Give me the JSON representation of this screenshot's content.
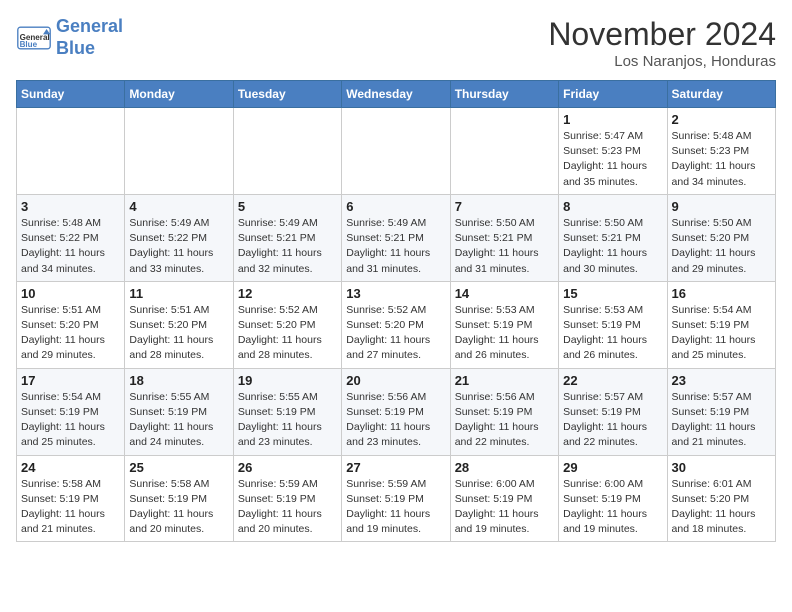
{
  "header": {
    "logo_line1": "General",
    "logo_line2": "Blue",
    "month_year": "November 2024",
    "location": "Los Naranjos, Honduras"
  },
  "days_of_week": [
    "Sunday",
    "Monday",
    "Tuesday",
    "Wednesday",
    "Thursday",
    "Friday",
    "Saturday"
  ],
  "weeks": [
    [
      {
        "day": "",
        "info": ""
      },
      {
        "day": "",
        "info": ""
      },
      {
        "day": "",
        "info": ""
      },
      {
        "day": "",
        "info": ""
      },
      {
        "day": "",
        "info": ""
      },
      {
        "day": "1",
        "info": "Sunrise: 5:47 AM\nSunset: 5:23 PM\nDaylight: 11 hours\nand 35 minutes."
      },
      {
        "day": "2",
        "info": "Sunrise: 5:48 AM\nSunset: 5:23 PM\nDaylight: 11 hours\nand 34 minutes."
      }
    ],
    [
      {
        "day": "3",
        "info": "Sunrise: 5:48 AM\nSunset: 5:22 PM\nDaylight: 11 hours\nand 34 minutes."
      },
      {
        "day": "4",
        "info": "Sunrise: 5:49 AM\nSunset: 5:22 PM\nDaylight: 11 hours\nand 33 minutes."
      },
      {
        "day": "5",
        "info": "Sunrise: 5:49 AM\nSunset: 5:21 PM\nDaylight: 11 hours\nand 32 minutes."
      },
      {
        "day": "6",
        "info": "Sunrise: 5:49 AM\nSunset: 5:21 PM\nDaylight: 11 hours\nand 31 minutes."
      },
      {
        "day": "7",
        "info": "Sunrise: 5:50 AM\nSunset: 5:21 PM\nDaylight: 11 hours\nand 31 minutes."
      },
      {
        "day": "8",
        "info": "Sunrise: 5:50 AM\nSunset: 5:21 PM\nDaylight: 11 hours\nand 30 minutes."
      },
      {
        "day": "9",
        "info": "Sunrise: 5:50 AM\nSunset: 5:20 PM\nDaylight: 11 hours\nand 29 minutes."
      }
    ],
    [
      {
        "day": "10",
        "info": "Sunrise: 5:51 AM\nSunset: 5:20 PM\nDaylight: 11 hours\nand 29 minutes."
      },
      {
        "day": "11",
        "info": "Sunrise: 5:51 AM\nSunset: 5:20 PM\nDaylight: 11 hours\nand 28 minutes."
      },
      {
        "day": "12",
        "info": "Sunrise: 5:52 AM\nSunset: 5:20 PM\nDaylight: 11 hours\nand 28 minutes."
      },
      {
        "day": "13",
        "info": "Sunrise: 5:52 AM\nSunset: 5:20 PM\nDaylight: 11 hours\nand 27 minutes."
      },
      {
        "day": "14",
        "info": "Sunrise: 5:53 AM\nSunset: 5:19 PM\nDaylight: 11 hours\nand 26 minutes."
      },
      {
        "day": "15",
        "info": "Sunrise: 5:53 AM\nSunset: 5:19 PM\nDaylight: 11 hours\nand 26 minutes."
      },
      {
        "day": "16",
        "info": "Sunrise: 5:54 AM\nSunset: 5:19 PM\nDaylight: 11 hours\nand 25 minutes."
      }
    ],
    [
      {
        "day": "17",
        "info": "Sunrise: 5:54 AM\nSunset: 5:19 PM\nDaylight: 11 hours\nand 25 minutes."
      },
      {
        "day": "18",
        "info": "Sunrise: 5:55 AM\nSunset: 5:19 PM\nDaylight: 11 hours\nand 24 minutes."
      },
      {
        "day": "19",
        "info": "Sunrise: 5:55 AM\nSunset: 5:19 PM\nDaylight: 11 hours\nand 23 minutes."
      },
      {
        "day": "20",
        "info": "Sunrise: 5:56 AM\nSunset: 5:19 PM\nDaylight: 11 hours\nand 23 minutes."
      },
      {
        "day": "21",
        "info": "Sunrise: 5:56 AM\nSunset: 5:19 PM\nDaylight: 11 hours\nand 22 minutes."
      },
      {
        "day": "22",
        "info": "Sunrise: 5:57 AM\nSunset: 5:19 PM\nDaylight: 11 hours\nand 22 minutes."
      },
      {
        "day": "23",
        "info": "Sunrise: 5:57 AM\nSunset: 5:19 PM\nDaylight: 11 hours\nand 21 minutes."
      }
    ],
    [
      {
        "day": "24",
        "info": "Sunrise: 5:58 AM\nSunset: 5:19 PM\nDaylight: 11 hours\nand 21 minutes."
      },
      {
        "day": "25",
        "info": "Sunrise: 5:58 AM\nSunset: 5:19 PM\nDaylight: 11 hours\nand 20 minutes."
      },
      {
        "day": "26",
        "info": "Sunrise: 5:59 AM\nSunset: 5:19 PM\nDaylight: 11 hours\nand 20 minutes."
      },
      {
        "day": "27",
        "info": "Sunrise: 5:59 AM\nSunset: 5:19 PM\nDaylight: 11 hours\nand 19 minutes."
      },
      {
        "day": "28",
        "info": "Sunrise: 6:00 AM\nSunset: 5:19 PM\nDaylight: 11 hours\nand 19 minutes."
      },
      {
        "day": "29",
        "info": "Sunrise: 6:00 AM\nSunset: 5:19 PM\nDaylight: 11 hours\nand 19 minutes."
      },
      {
        "day": "30",
        "info": "Sunrise: 6:01 AM\nSunset: 5:20 PM\nDaylight: 11 hours\nand 18 minutes."
      }
    ]
  ]
}
